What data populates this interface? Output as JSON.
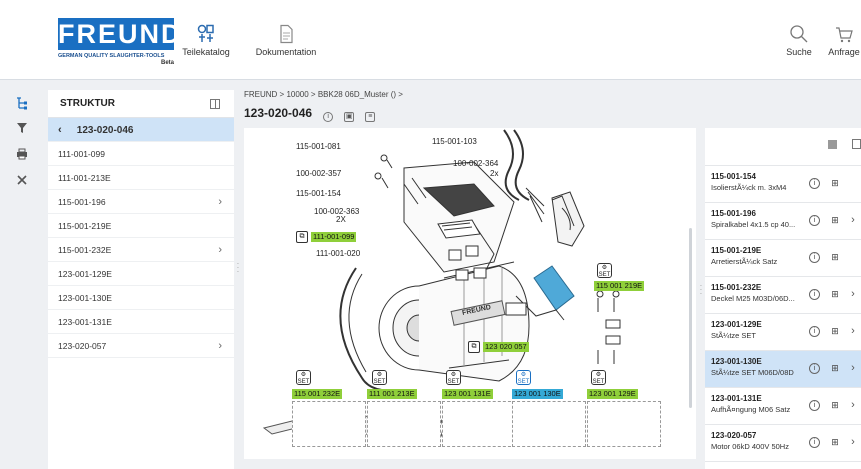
{
  "header": {
    "logo_text": "FREUND",
    "logo_tagline": "GERMAN QUALITY SLAUGHTER-TOOLS",
    "logo_beta": "Beta",
    "nav": [
      {
        "label": "Teilekatalog",
        "icon": "parts-catalog-icon"
      },
      {
        "label": "Dokumentation",
        "icon": "document-icon"
      },
      {
        "label": "Suche",
        "icon": "search-icon"
      },
      {
        "label": "Anfrage",
        "icon": "cart-icon"
      }
    ]
  },
  "sidebar_tools": [
    "tree-icon",
    "filter-icon",
    "print-icon",
    "tools-icon"
  ],
  "structure": {
    "heading": "STRUKTUR",
    "current": "123-020-046",
    "items": [
      {
        "label": "111-001-099",
        "has_children": false
      },
      {
        "label": "111-001-213E",
        "has_children": false
      },
      {
        "label": "115-001-196",
        "has_children": true
      },
      {
        "label": "115-001-219E",
        "has_children": false
      },
      {
        "label": "115-001-232E",
        "has_children": true
      },
      {
        "label": "123-001-129E",
        "has_children": false
      },
      {
        "label": "123-001-130E",
        "has_children": false
      },
      {
        "label": "123-001-131E",
        "has_children": false
      },
      {
        "label": "123-020-057",
        "has_children": true
      }
    ]
  },
  "breadcrumb": "FREUND > 10000 > BBK28 06D_Muster () >",
  "page_title": "123-020-046",
  "diagram": {
    "callouts": [
      "115-001-081",
      "115-001-103",
      "100-002-357",
      "100-002-364",
      "2x",
      "115-001-154",
      "100-002-363",
      "2X",
      "111-001-020"
    ],
    "highlighted_green": [
      "111-001-099",
      "115 001 219E",
      "123 020 057",
      "115 001 232E",
      "111 001 213E",
      "123 001 131E",
      "123 001 129E"
    ],
    "highlighted_blue": [
      "123 001 130E"
    ],
    "brand_on_part": "FREUND",
    "set_icon_text": "SET"
  },
  "parts": [
    {
      "number": "115-001-154",
      "desc": "IsolierstÃ¼ck m. 3xM4",
      "has_children": false,
      "selected": false
    },
    {
      "number": "115-001-196",
      "desc": "Spiralkabel 4x1.5 cp 40...",
      "has_children": true,
      "selected": false
    },
    {
      "number": "115-001-219E",
      "desc": "ArretierstÃ¼ck Satz",
      "has_children": false,
      "selected": false
    },
    {
      "number": "115-001-232E",
      "desc": "Deckel M25 M03D/06D...",
      "has_children": true,
      "selected": false
    },
    {
      "number": "123-001-129E",
      "desc": "StÃ¼tze SET",
      "has_children": true,
      "selected": false
    },
    {
      "number": "123-001-130E",
      "desc": "StÃ¼tze SET M06D/08D",
      "has_children": true,
      "selected": true
    },
    {
      "number": "123-001-131E",
      "desc": "AufhÃ¤ngung M06 Satz",
      "has_children": true,
      "selected": false
    },
    {
      "number": "123-020-057",
      "desc": "Motor 06kD 400V 50Hz",
      "has_children": true,
      "selected": false
    }
  ],
  "colors": {
    "brand_blue": "#1a6fc2",
    "highlight_green": "#8fcf3a",
    "highlight_blue": "#34a9d6",
    "selected_row": "#cfe3f7"
  }
}
